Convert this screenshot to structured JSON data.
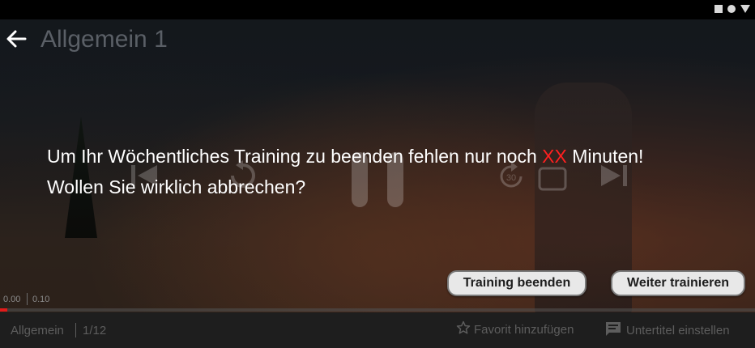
{
  "header": {
    "title": "Allgemein 1"
  },
  "dialog": {
    "message_part1": "Um Ihr Wöchentliches Training zu beenden fehlen nur noch ",
    "highlight": "XX",
    "message_part2": " Minuten!",
    "message_line2": "Wollen Sie wirklich abbrechen?",
    "end_button_label": "Training beenden",
    "continue_button_label": "Weiter trainieren"
  },
  "player": {
    "time_current": "0.00",
    "time_total": "0.10",
    "progress_fraction": 0.01,
    "rewind_label": "30"
  },
  "bottom": {
    "category": "Allgemein",
    "counter": "1/12",
    "favorite_label": "Favorit hinzufügen",
    "subtitles_label": "Untertitel einstellen"
  },
  "colors": {
    "highlight": "#ff2020",
    "progress": "#e21b1b",
    "button_bg": "#e8e8e8"
  },
  "icons": [
    "back-arrow-icon",
    "skip-previous-icon",
    "replay-icon",
    "pause-icon",
    "replay-30-icon",
    "forward-icon",
    "skip-next-icon",
    "star-icon",
    "subtitles-icon"
  ]
}
